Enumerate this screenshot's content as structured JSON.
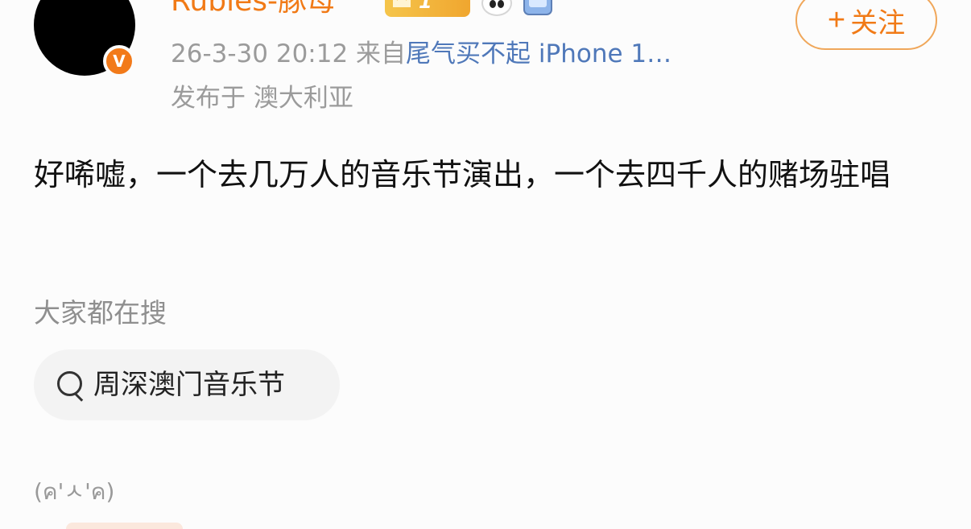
{
  "post": {
    "author": {
      "name": "Rubles-豚母",
      "verified": true,
      "badge_level": "1",
      "icons": [
        "crown-level-badge-icon",
        "panda-icon",
        "tv-icon"
      ]
    },
    "follow_button": {
      "icon": "+",
      "label": "关注"
    },
    "meta": {
      "timestamp": "26-3-30 20:12",
      "source_prefix": "来自",
      "source_app": "尾气买不起 iPhone 1…",
      "location": "发布于 澳大利亚"
    },
    "content": "好唏嘘，一个去几万人的音乐节演出，一个去四千人的赌场驻唱",
    "kaomoji": "(ค'ㅅ'ค)"
  },
  "trending": {
    "title": "大家都在搜",
    "search_term": "周深澳门音乐节"
  },
  "colors": {
    "brand_orange": "#f17a16",
    "link_blue": "#4f78b9",
    "meta_gray": "#9b9b9b",
    "background": "#fcfcfc"
  }
}
